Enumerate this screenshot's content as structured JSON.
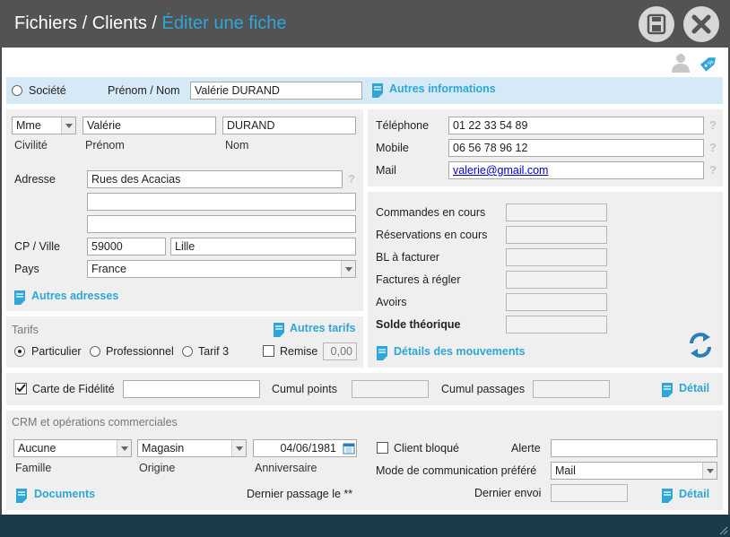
{
  "header": {
    "crumb1": "Fichiers",
    "crumb2": "Clients",
    "sep": "/",
    "current": "Éditer une fiche"
  },
  "top": {
    "societe_label": "Société",
    "prenom_nom_label": "Prénom / Nom",
    "prenom_nom_value": "Valérie DURAND",
    "autres_infos": "Autres informations"
  },
  "identity": {
    "civilite_value": "Mme",
    "prenom_value": "Valérie",
    "nom_value": "DURAND",
    "civilite_label": "Civilité",
    "prenom_label": "Prénom",
    "nom_label": "Nom",
    "adresse_label": "Adresse",
    "adresse1": "Rues des Acacias",
    "adresse2": "",
    "adresse3": "",
    "cpville_label": "CP / Ville",
    "cp_value": "59000",
    "ville_value": "Lille",
    "pays_label": "Pays",
    "pays_value": "France",
    "autres_adresses": "Autres adresses"
  },
  "contact": {
    "telephone_label": "Téléphone",
    "telephone_value": "01 22 33 54 89",
    "mobile_label": "Mobile",
    "mobile_value": "06 56 78 96 12",
    "mail_label": "Mail",
    "mail_value": "valerie@gmail.com",
    "help": "?"
  },
  "stats": {
    "commandes": "Commandes en cours",
    "reservations": "Réservations en cours",
    "bl": "BL à facturer",
    "factures": "Factures à régler",
    "avoirs": "Avoirs",
    "solde": "Solde théorique",
    "details": "Détails des mouvements"
  },
  "tarifs": {
    "title": "Tarifs",
    "autres": "Autres tarifs",
    "particulier": "Particulier",
    "professionnel": "Professionnel",
    "tarif3": "Tarif 3",
    "remise_label": "Remise",
    "remise_value": "0,00"
  },
  "fidelite": {
    "carte_label": "Carte de Fidélité",
    "carte_value": "",
    "cumul_points": "Cumul points",
    "cumul_passages": "Cumul passages",
    "detail": "Détail"
  },
  "crm": {
    "title": "CRM et opérations commerciales",
    "famille_value": "Aucune",
    "origine_value": "Magasin",
    "anniversaire_value": "04/06/1981",
    "famille_label": "Famille",
    "origine_label": "Origine",
    "anniversaire_label": "Anniversaire",
    "documents": "Documents",
    "dernier_passage": "Dernier passage le **",
    "client_bloque": "Client bloqué",
    "alerte_label": "Alerte",
    "mode_comm_label": "Mode de communication préféré",
    "mode_comm_value": "Mail",
    "dernier_envoi": "Dernier envoi",
    "detail": "Détail"
  },
  "colors": {
    "accent": "#2fa6d6",
    "titlebar": "#535353",
    "footer": "#1c3a4a",
    "highlight_row": "#d5eaf6",
    "panel": "#efefef"
  }
}
